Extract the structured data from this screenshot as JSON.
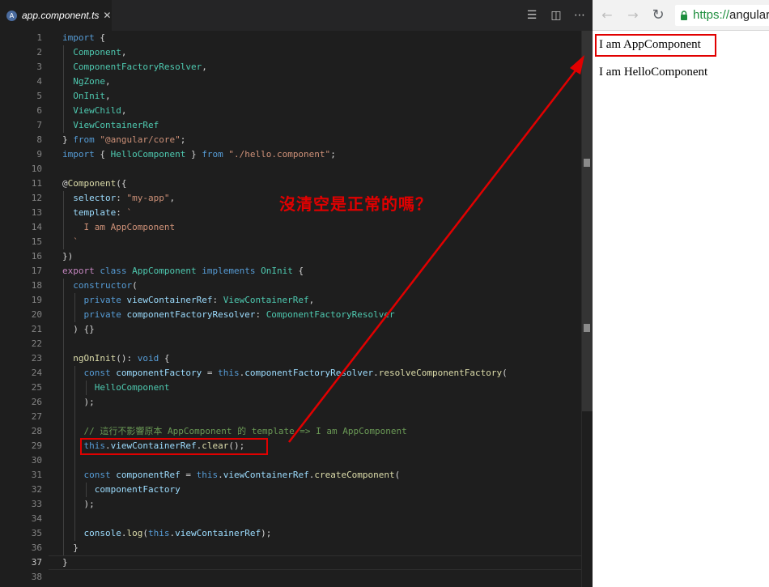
{
  "editor": {
    "tab": {
      "label": "app.component.ts",
      "close": "✕",
      "icon": "angular-icon"
    },
    "actions": [
      {
        "name": "outline-icon",
        "glyph": "☰"
      },
      {
        "name": "split-editor-icon",
        "glyph": "◫"
      },
      {
        "name": "more-actions-icon",
        "glyph": "⋯"
      }
    ],
    "active_line": 37,
    "lines": [
      [
        [
          "kw",
          "import"
        ],
        [
          "pl",
          " {"
        ]
      ],
      [
        [
          "pl",
          "  "
        ],
        [
          "ty",
          "Component"
        ],
        [
          "pl",
          ","
        ]
      ],
      [
        [
          "pl",
          "  "
        ],
        [
          "ty",
          "ComponentFactoryResolver"
        ],
        [
          "pl",
          ","
        ]
      ],
      [
        [
          "pl",
          "  "
        ],
        [
          "ty",
          "NgZone"
        ],
        [
          "pl",
          ","
        ]
      ],
      [
        [
          "pl",
          "  "
        ],
        [
          "ty",
          "OnInit"
        ],
        [
          "pl",
          ","
        ]
      ],
      [
        [
          "pl",
          "  "
        ],
        [
          "ty",
          "ViewChild"
        ],
        [
          "pl",
          ","
        ]
      ],
      [
        [
          "pl",
          "  "
        ],
        [
          "ty",
          "ViewContainerRef"
        ]
      ],
      [
        [
          "pl",
          "} "
        ],
        [
          "kw",
          "from"
        ],
        [
          "pl",
          " "
        ],
        [
          "str",
          "\"@angular/core\""
        ],
        [
          "pl",
          ";"
        ]
      ],
      [
        [
          "kw",
          "import"
        ],
        [
          "pl",
          " { "
        ],
        [
          "ty",
          "HelloComponent"
        ],
        [
          "pl",
          " } "
        ],
        [
          "kw",
          "from"
        ],
        [
          "pl",
          " "
        ],
        [
          "str",
          "\"./hello.component\""
        ],
        [
          "pl",
          ";"
        ]
      ],
      [],
      [
        [
          "pl",
          "@"
        ],
        [
          "fn",
          "Component"
        ],
        [
          "pl",
          "({"
        ]
      ],
      [
        [
          "pl",
          "  "
        ],
        [
          "var",
          "selector"
        ],
        [
          "pl",
          ": "
        ],
        [
          "str",
          "\"my-app\""
        ],
        [
          "pl",
          ","
        ]
      ],
      [
        [
          "pl",
          "  "
        ],
        [
          "var",
          "template"
        ],
        [
          "pl",
          ": "
        ],
        [
          "str",
          "`"
        ]
      ],
      [
        [
          "pl",
          "    "
        ],
        [
          "str",
          "I am AppComponent"
        ]
      ],
      [
        [
          "pl",
          "  "
        ],
        [
          "str",
          "`"
        ]
      ],
      [
        [
          "pl",
          "})"
        ]
      ],
      [
        [
          "cf",
          "export"
        ],
        [
          "pl",
          " "
        ],
        [
          "kw",
          "class"
        ],
        [
          "pl",
          " "
        ],
        [
          "ty",
          "AppComponent"
        ],
        [
          "pl",
          " "
        ],
        [
          "kw",
          "implements"
        ],
        [
          "pl",
          " "
        ],
        [
          "ty",
          "OnInit"
        ],
        [
          "pl",
          " {"
        ]
      ],
      [
        [
          "pl",
          "  "
        ],
        [
          "kw",
          "constructor"
        ],
        [
          "pl",
          "("
        ]
      ],
      [
        [
          "pl",
          "    "
        ],
        [
          "kw",
          "private"
        ],
        [
          "pl",
          " "
        ],
        [
          "var",
          "viewContainerRef"
        ],
        [
          "pl",
          ": "
        ],
        [
          "ty",
          "ViewContainerRef"
        ],
        [
          "pl",
          ","
        ]
      ],
      [
        [
          "pl",
          "    "
        ],
        [
          "kw",
          "private"
        ],
        [
          "pl",
          " "
        ],
        [
          "var",
          "componentFactoryResolver"
        ],
        [
          "pl",
          ": "
        ],
        [
          "ty",
          "ComponentFactoryResolver"
        ]
      ],
      [
        [
          "pl",
          "  ) {}"
        ]
      ],
      [],
      [
        [
          "pl",
          "  "
        ],
        [
          "fn",
          "ngOnInit"
        ],
        [
          "pl",
          "(): "
        ],
        [
          "kw",
          "void"
        ],
        [
          "pl",
          " {"
        ]
      ],
      [
        [
          "pl",
          "    "
        ],
        [
          "kw",
          "const"
        ],
        [
          "pl",
          " "
        ],
        [
          "var",
          "componentFactory"
        ],
        [
          "pl",
          " = "
        ],
        [
          "kw",
          "this"
        ],
        [
          "pl",
          "."
        ],
        [
          "var",
          "componentFactoryResolver"
        ],
        [
          "pl",
          "."
        ],
        [
          "fn",
          "resolveComponentFactory"
        ],
        [
          "pl",
          "("
        ]
      ],
      [
        [
          "pl",
          "      "
        ],
        [
          "ty",
          "HelloComponent"
        ]
      ],
      [
        [
          "pl",
          "    );"
        ]
      ],
      [],
      [
        [
          "pl",
          "    "
        ],
        [
          "cm",
          "// 這行不影響原本 AppComponent 的 template => I am AppComponent"
        ]
      ],
      [
        [
          "pl",
          "    "
        ],
        [
          "kw",
          "this"
        ],
        [
          "pl",
          "."
        ],
        [
          "var",
          "viewContainerRef"
        ],
        [
          "pl",
          "."
        ],
        [
          "fn",
          "clear"
        ],
        [
          "pl",
          "();"
        ]
      ],
      [],
      [
        [
          "pl",
          "    "
        ],
        [
          "kw",
          "const"
        ],
        [
          "pl",
          " "
        ],
        [
          "var",
          "componentRef"
        ],
        [
          "pl",
          " = "
        ],
        [
          "kw",
          "this"
        ],
        [
          "pl",
          "."
        ],
        [
          "var",
          "viewContainerRef"
        ],
        [
          "pl",
          "."
        ],
        [
          "fn",
          "createComponent"
        ],
        [
          "pl",
          "("
        ]
      ],
      [
        [
          "pl",
          "      "
        ],
        [
          "var",
          "componentFactory"
        ]
      ],
      [
        [
          "pl",
          "    );"
        ]
      ],
      [],
      [
        [
          "pl",
          "    "
        ],
        [
          "var",
          "console"
        ],
        [
          "pl",
          "."
        ],
        [
          "fn",
          "log"
        ],
        [
          "pl",
          "("
        ],
        [
          "kw",
          "this"
        ],
        [
          "pl",
          "."
        ],
        [
          "var",
          "viewContainerRef"
        ],
        [
          "pl",
          ");"
        ]
      ],
      [
        [
          "pl",
          "  }"
        ]
      ],
      [
        [
          "pl",
          "}"
        ]
      ],
      []
    ]
  },
  "browser": {
    "nav": {
      "back": "←",
      "forward": "→",
      "reload": "↻"
    },
    "url": {
      "scheme": "https://",
      "rest": "angular"
    },
    "content": [
      {
        "text": "I am AppComponent"
      },
      {
        "text": "I am HelloComponent"
      }
    ]
  },
  "annotation": {
    "text": "沒清空是正常的嗎？",
    "color": "#e10000"
  }
}
